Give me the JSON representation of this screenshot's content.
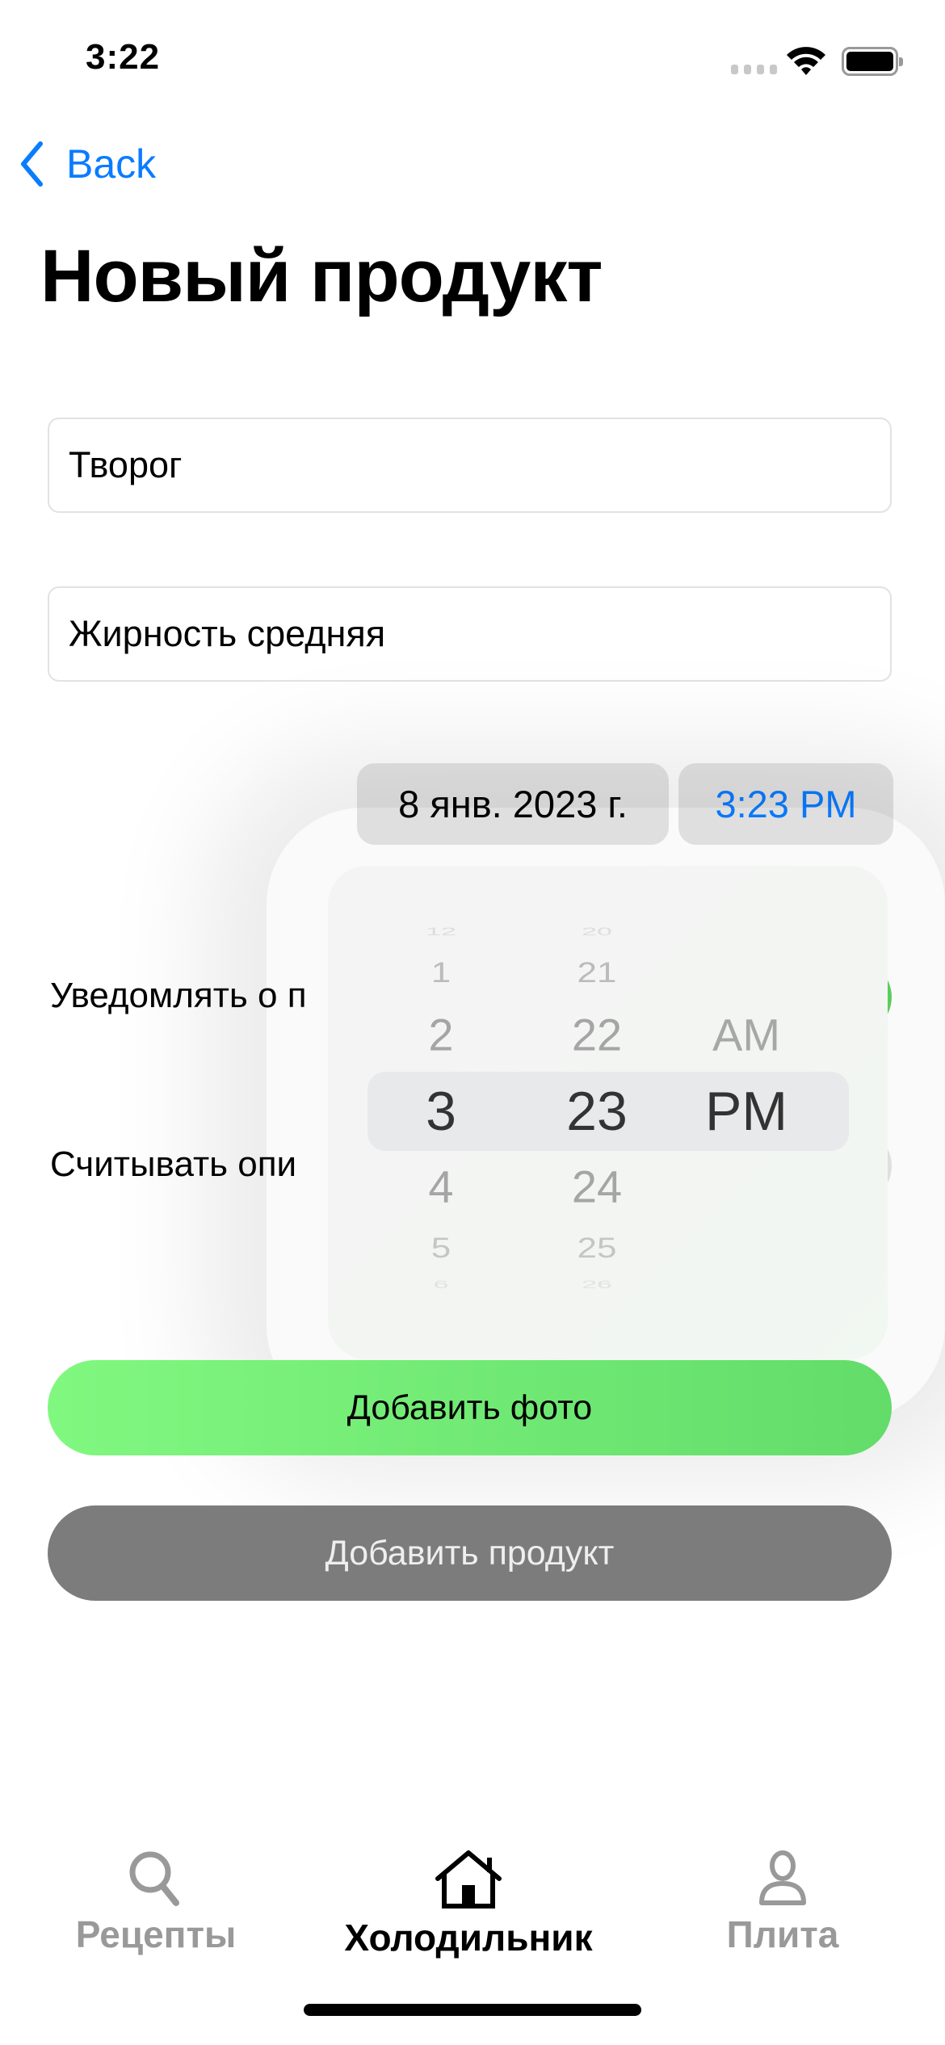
{
  "status_bar": {
    "time": "3:22"
  },
  "nav": {
    "back_label": "Back",
    "title": "Новый продукт"
  },
  "form": {
    "name_value": "Творог",
    "description_value": "Жирность средняя",
    "date_value": "8 янв. 2023 г.",
    "time_value": "3:23 PM",
    "notify_label": "Уведомлять о п",
    "notify_on": true,
    "scan_label": "Считывать опи",
    "scan_on": false,
    "add_photo_label": "Добавить фото",
    "add_product_label": "Добавить продукт"
  },
  "time_picker": {
    "hours": [
      "12",
      "1",
      "2",
      "3",
      "4",
      "5",
      "6"
    ],
    "minutes": [
      "20",
      "21",
      "22",
      "23",
      "24",
      "25",
      "26"
    ],
    "periods": [
      "AM",
      "PM"
    ],
    "selected_hour": "3",
    "selected_minute": "23",
    "selected_period": "PM"
  },
  "tab_bar": {
    "tabs": [
      {
        "label": "Рецепты",
        "icon": "search-icon",
        "active": false
      },
      {
        "label": "Холодильник",
        "icon": "house-icon",
        "active": true
      },
      {
        "label": "Плита",
        "icon": "person-icon",
        "active": false
      }
    ]
  },
  "colors": {
    "accent": "#0a7cff",
    "green_start": "#80f880",
    "green_end": "#63dc6a",
    "disabled_button": "#7c7c7c",
    "tab_inactive": "#999999"
  }
}
